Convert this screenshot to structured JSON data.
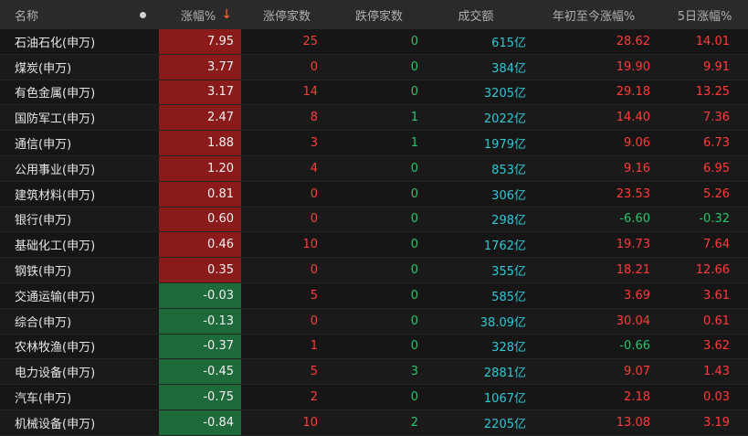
{
  "header": {
    "name": "名称",
    "change": "涨幅%",
    "sort_arrow": "↓",
    "limit_up": "涨停家数",
    "limit_down": "跌停家数",
    "volume": "成交额",
    "ytd": "年初至今涨幅%",
    "five_day": "5日涨幅%"
  },
  "colors": {
    "up": "#ff3b3b",
    "down": "#27c46b",
    "up_bg": "#8b1a1a",
    "down_bg": "#1f6a3a",
    "volume": "#33c6d4"
  },
  "rows": [
    {
      "name": "石油石化(申万)",
      "change": "7.95",
      "limit_up": "25",
      "limit_down": "0",
      "volume": "615亿",
      "ytd": "28.62",
      "five_day": "14.01"
    },
    {
      "name": "煤炭(申万)",
      "change": "3.77",
      "limit_up": "0",
      "limit_down": "0",
      "volume": "384亿",
      "ytd": "19.90",
      "five_day": "9.91"
    },
    {
      "name": "有色金属(申万)",
      "change": "3.17",
      "limit_up": "14",
      "limit_down": "0",
      "volume": "3205亿",
      "ytd": "29.18",
      "five_day": "13.25"
    },
    {
      "name": "国防军工(申万)",
      "change": "2.47",
      "limit_up": "8",
      "limit_down": "1",
      "volume": "2022亿",
      "ytd": "14.40",
      "five_day": "7.36"
    },
    {
      "name": "通信(申万)",
      "change": "1.88",
      "limit_up": "3",
      "limit_down": "1",
      "volume": "1979亿",
      "ytd": "9.06",
      "five_day": "6.73"
    },
    {
      "name": "公用事业(申万)",
      "change": "1.20",
      "limit_up": "4",
      "limit_down": "0",
      "volume": "853亿",
      "ytd": "9.16",
      "five_day": "6.95"
    },
    {
      "name": "建筑材料(申万)",
      "change": "0.81",
      "limit_up": "0",
      "limit_down": "0",
      "volume": "306亿",
      "ytd": "23.53",
      "five_day": "5.26"
    },
    {
      "name": "银行(申万)",
      "change": "0.60",
      "limit_up": "0",
      "limit_down": "0",
      "volume": "298亿",
      "ytd": "-6.60",
      "five_day": "-0.32"
    },
    {
      "name": "基础化工(申万)",
      "change": "0.46",
      "limit_up": "10",
      "limit_down": "0",
      "volume": "1762亿",
      "ytd": "19.73",
      "five_day": "7.64"
    },
    {
      "name": "钢铁(申万)",
      "change": "0.35",
      "limit_up": "0",
      "limit_down": "0",
      "volume": "355亿",
      "ytd": "18.21",
      "five_day": "12.66"
    },
    {
      "name": "交通运输(申万)",
      "change": "-0.03",
      "limit_up": "5",
      "limit_down": "0",
      "volume": "585亿",
      "ytd": "3.69",
      "five_day": "3.61"
    },
    {
      "name": "综合(申万)",
      "change": "-0.13",
      "limit_up": "0",
      "limit_down": "0",
      "volume": "38.09亿",
      "ytd": "30.04",
      "five_day": "0.61"
    },
    {
      "name": "农林牧渔(申万)",
      "change": "-0.37",
      "limit_up": "1",
      "limit_down": "0",
      "volume": "328亿",
      "ytd": "-0.66",
      "five_day": "3.62"
    },
    {
      "name": "电力设备(申万)",
      "change": "-0.45",
      "limit_up": "5",
      "limit_down": "3",
      "volume": "2881亿",
      "ytd": "9.07",
      "five_day": "1.43"
    },
    {
      "name": "汽车(申万)",
      "change": "-0.75",
      "limit_up": "2",
      "limit_down": "0",
      "volume": "1067亿",
      "ytd": "2.18",
      "five_day": "0.03"
    },
    {
      "name": "机械设备(申万)",
      "change": "-0.84",
      "limit_up": "10",
      "limit_down": "2",
      "volume": "2205亿",
      "ytd": "13.08",
      "five_day": "3.19"
    }
  ]
}
